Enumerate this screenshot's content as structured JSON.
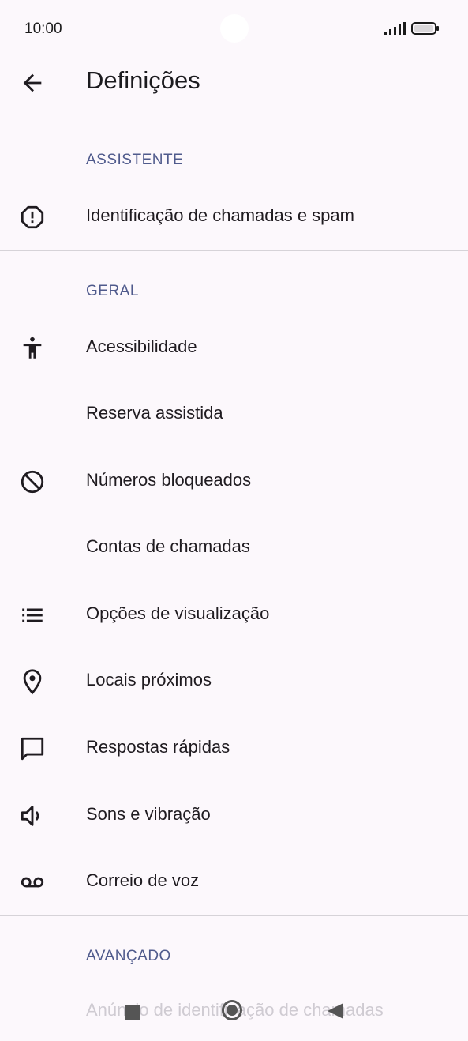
{
  "status_bar": {
    "time": "10:00"
  },
  "app_bar": {
    "title": "Definições"
  },
  "sections": {
    "assistant": {
      "header": "ASSISTENTE",
      "items": [
        {
          "label": "Identificação de chamadas e spam",
          "icon": "alert-octagon-icon"
        }
      ]
    },
    "general": {
      "header": "GERAL",
      "items": [
        {
          "label": "Acessibilidade",
          "icon": "accessibility-icon"
        },
        {
          "label": "Reserva assistida",
          "icon": ""
        },
        {
          "label": "Números bloqueados",
          "icon": "block-icon"
        },
        {
          "label": "Contas de chamadas",
          "icon": ""
        },
        {
          "label": "Opções de visualização",
          "icon": "list-icon"
        },
        {
          "label": "Locais próximos",
          "icon": "location-pin-icon"
        },
        {
          "label": "Respostas rápidas",
          "icon": "chat-bubble-icon"
        },
        {
          "label": "Sons e vibração",
          "icon": "volume-icon"
        },
        {
          "label": "Correio de voz",
          "icon": "voicemail-icon"
        }
      ]
    },
    "advanced": {
      "header": "AVANÇADO",
      "peek_item": "Anúncio de identificação de chamadas"
    }
  }
}
